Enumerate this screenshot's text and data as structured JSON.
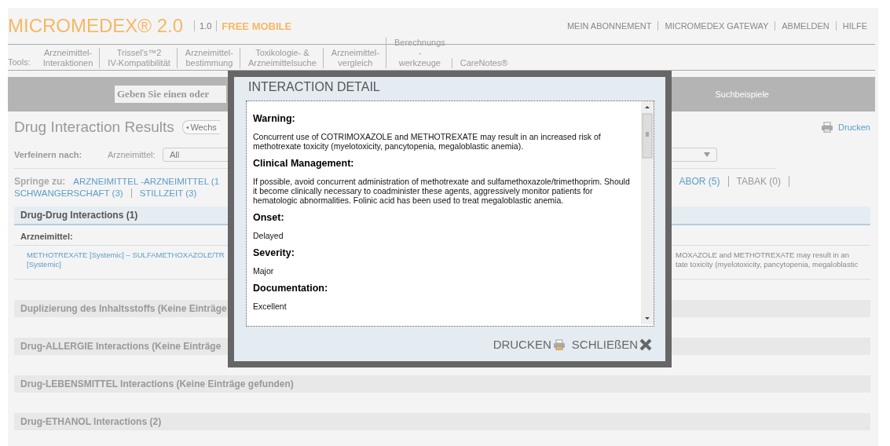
{
  "header": {
    "logo": "MICROMEDEX® 2.0",
    "version": "1.0",
    "edition": "FREE MOBILE",
    "links": [
      "MEIN ABONNEMENT",
      "MICROMEDEX GATEWAY",
      "ABMELDEN",
      "HILFE"
    ]
  },
  "tools": {
    "label": "Tools:",
    "items": [
      {
        "lines": [
          "Arzneimittel-",
          "Interaktionen"
        ]
      },
      {
        "lines": [
          "Trissel's™2",
          "IV-Kompatibilität"
        ]
      },
      {
        "lines": [
          "Arzneimittel-",
          "bestimmung"
        ]
      },
      {
        "lines": [
          "Toxikologie- &",
          "Arzneimittelsuche"
        ]
      },
      {
        "lines": [
          "Arzneimittel-",
          "vergleich"
        ]
      },
      {
        "lines": [
          "Berechnungs",
          "-",
          "werkzeuge"
        ]
      },
      {
        "lines": [
          "CareNotes®"
        ]
      }
    ]
  },
  "search": {
    "placeholder": "Geben Sie einen oder",
    "examples": "Suchbeispiele"
  },
  "results": {
    "title": "Drug Interaction Results",
    "change_button": "Wechs",
    "print": "Drucken"
  },
  "refine": {
    "label": "Verfeinern nach:",
    "drug_label": "Arzneimittel:",
    "drug_value": "All"
  },
  "jump": {
    "label": "Springe zu:",
    "lines": [
      {
        "left": [
          {
            "text": "ARZNEIMITTEL -ARZNEIMITTEL (1",
            "disabled": false
          }
        ],
        "right": [
          {
            "text": "ABOR (5)",
            "disabled": false
          },
          {
            "text": "TABAK (0)",
            "disabled": true
          }
        ]
      },
      {
        "left": [
          {
            "text": "SCHWANGERSCHAFT (3)",
            "disabled": false
          },
          {
            "text": "STILLZEIT (3)",
            "disabled": false
          }
        ]
      }
    ]
  },
  "interaction_groups": [
    {
      "kind": "results",
      "title": "Drug-Drug Interactions (1)",
      "subheader": "Arzneimittel:",
      "rows": [
        {
          "drugs": [
            "METHOTREXATE [Systemic] – SULFAMETHOXAZOLE/TR",
            "[Systemic]"
          ],
          "summary": [
            "MOXAZOLE and METHOTREXATE may result in an",
            "tate toxicity (myelotoxicity, pancytopenia, megaloblastic"
          ]
        }
      ]
    },
    {
      "kind": "empty",
      "title": "Duplizierung des Inhaltsstoffs (Keine Einträge"
    },
    {
      "kind": "empty",
      "title": "Drug-ALLERGIE Interactions (Keine Einträge"
    },
    {
      "kind": "empty",
      "title": "Drug-LEBENSMITTEL Interactions (Keine Einträge gefunden)"
    },
    {
      "kind": "empty",
      "title": "Drug-ETHANOL Interactions (2)"
    }
  ],
  "modal": {
    "title": "INTERACTION DETAIL",
    "sections": [
      {
        "heading": "Warning:",
        "text": "Concurrent use of COTRIMOXAZOLE and METHOTREXATE may result in an increased risk of methotrexate toxicity (myelotoxicity, pancytopenia, megaloblastic anemia)."
      },
      {
        "heading": "Clinical Management:",
        "text": "If possible, avoid concurrent administration of methotrexate and sulfamethoxazole/trimethoprim. Should it become clinically necessary to coadminister these agents, aggressively monitor patients for hematologic abnormalities. Folinic acid has been used to treat megaloblastic anemia."
      },
      {
        "heading": "Onset:",
        "text": "Delayed"
      },
      {
        "heading": "Severity:",
        "text": "Major"
      },
      {
        "heading": "Documentation:",
        "text": "Excellent"
      }
    ],
    "buttons": [
      {
        "kind": "print",
        "label": "DRUCKEN"
      },
      {
        "kind": "close",
        "label": "SCHLIEßEN"
      }
    ]
  }
}
